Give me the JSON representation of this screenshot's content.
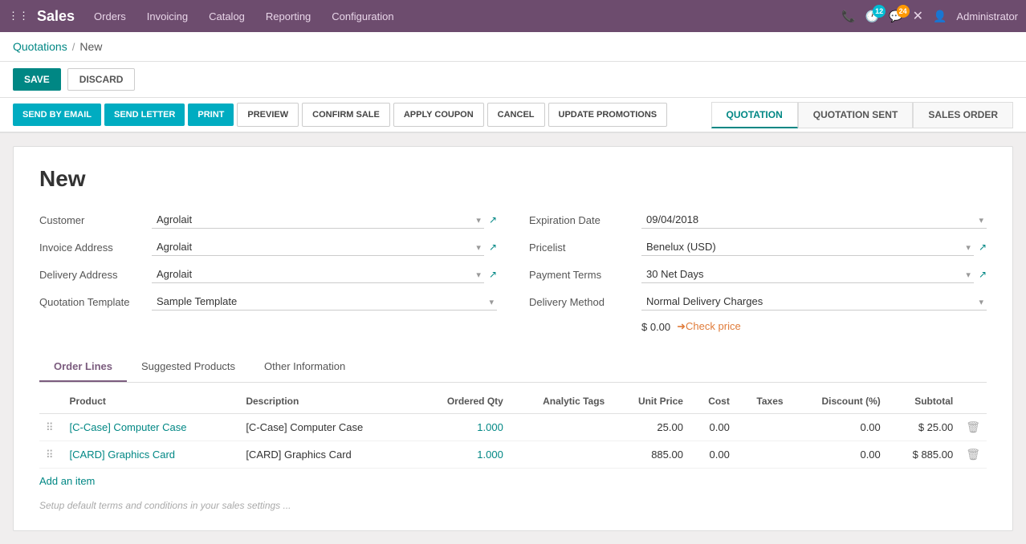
{
  "app": {
    "title": "Sales",
    "grid_icon": "⊞"
  },
  "topnav": {
    "menu_items": [
      "Orders",
      "Invoicing",
      "Catalog",
      "Reporting",
      "Configuration"
    ],
    "badge1": "12",
    "badge2": "24",
    "user": "Administrator"
  },
  "breadcrumb": {
    "parent": "Quotations",
    "current": "New"
  },
  "actions": {
    "save": "SAVE",
    "discard": "DISCARD"
  },
  "toolbar": {
    "send_email": "SEND BY EMAIL",
    "send_letter": "SEND LETTER",
    "print": "PRINT",
    "preview": "PREVIEW",
    "confirm_sale": "CONFIRM SALE",
    "apply_coupon": "APPLY COUPON",
    "cancel": "CANCEL",
    "update_promotions": "UPDATE PROMOTIONS"
  },
  "status_steps": {
    "quotation": "QUOTATION",
    "quotation_sent": "QUOTATION SENT",
    "sales_order": "SALES ORDER"
  },
  "form": {
    "title": "New",
    "left": {
      "customer_label": "Customer",
      "customer_value": "Agrolait",
      "invoice_address_label": "Invoice Address",
      "invoice_address_value": "Agrolait",
      "delivery_address_label": "Delivery Address",
      "delivery_address_value": "Agrolait",
      "quotation_template_label": "Quotation Template",
      "quotation_template_value": "Sample Template"
    },
    "right": {
      "expiration_date_label": "Expiration Date",
      "expiration_date_value": "09/04/2018",
      "pricelist_label": "Pricelist",
      "pricelist_value": "Benelux (USD)",
      "payment_terms_label": "Payment Terms",
      "payment_terms_value": "30 Net Days",
      "delivery_method_label": "Delivery Method",
      "delivery_method_value": "Normal Delivery Charges",
      "delivery_price": "$ 0.00",
      "check_price": "➜Check price"
    }
  },
  "tabs": {
    "order_lines": "Order Lines",
    "suggested_products": "Suggested Products",
    "other_information": "Other Information"
  },
  "table": {
    "headers": [
      "",
      "Product",
      "Description",
      "Ordered Qty",
      "Analytic Tags",
      "Unit Price",
      "Cost",
      "Taxes",
      "Discount (%)",
      "Subtotal",
      ""
    ],
    "rows": [
      {
        "drag": "⠿",
        "product": "[C-Case] Computer Case",
        "description": "[C-Case] Computer Case",
        "ordered_qty": "1.000",
        "analytic_tags": "",
        "unit_price": "25.00",
        "cost": "0.00",
        "taxes": "",
        "discount": "0.00",
        "subtotal": "$ 25.00"
      },
      {
        "drag": "⠿",
        "product": "[CARD] Graphics Card",
        "description": "[CARD] Graphics Card",
        "ordered_qty": "1.000",
        "analytic_tags": "",
        "unit_price": "885.00",
        "cost": "0.00",
        "taxes": "",
        "discount": "0.00",
        "subtotal": "$ 885.00"
      }
    ],
    "add_item": "Add an item"
  },
  "footer": {
    "terms_hint": "Setup default terms and conditions in your sales settings ..."
  }
}
